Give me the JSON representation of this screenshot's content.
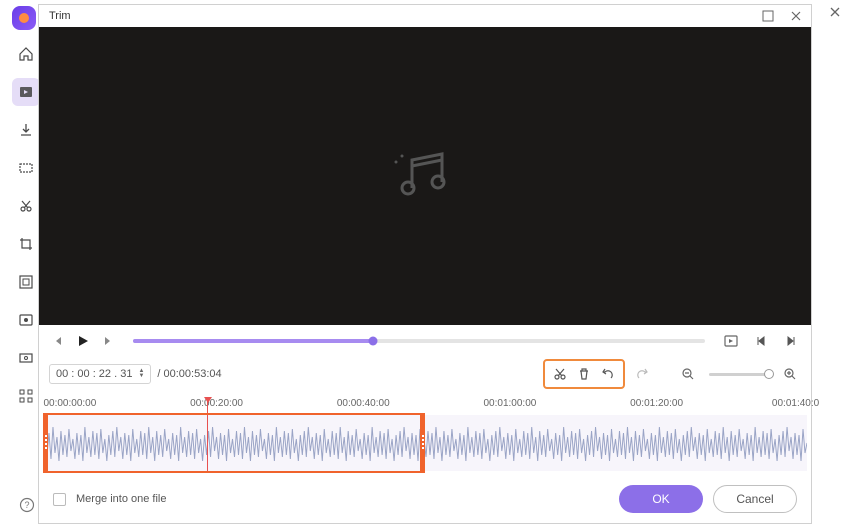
{
  "dialog": {
    "title": "Trim"
  },
  "sidebar": {
    "items": [
      {
        "name": "home-icon"
      },
      {
        "name": "convert-icon",
        "active": true
      },
      {
        "name": "download-icon"
      },
      {
        "name": "compress-icon"
      },
      {
        "name": "cut-icon"
      },
      {
        "name": "crop-icon"
      },
      {
        "name": "effects-icon"
      },
      {
        "name": "record-icon"
      },
      {
        "name": "disc-icon"
      },
      {
        "name": "apps-icon"
      }
    ]
  },
  "playback": {
    "current_time": "00 : 00 : 22 . 31",
    "total_time": "/ 00:00:53:04",
    "progress_percent": 42
  },
  "ruler": {
    "ticks": [
      "00:00:00:00",
      "00:00:20:00",
      "00:00:40:00",
      "00:01:00:00",
      "00:01:20:00",
      "00:01:40:0"
    ]
  },
  "selection": {
    "start_percent": 0,
    "end_percent": 50,
    "playhead_percent": 21.5
  },
  "bottom": {
    "merge_label": "Merge into one file",
    "ok_label": "OK",
    "cancel_label": "Cancel"
  },
  "tools": {
    "cut": "cut",
    "delete": "delete",
    "undo": "undo",
    "redo": "redo"
  },
  "colors": {
    "accent": "#8c6fe8",
    "highlight": "#f0632c"
  }
}
